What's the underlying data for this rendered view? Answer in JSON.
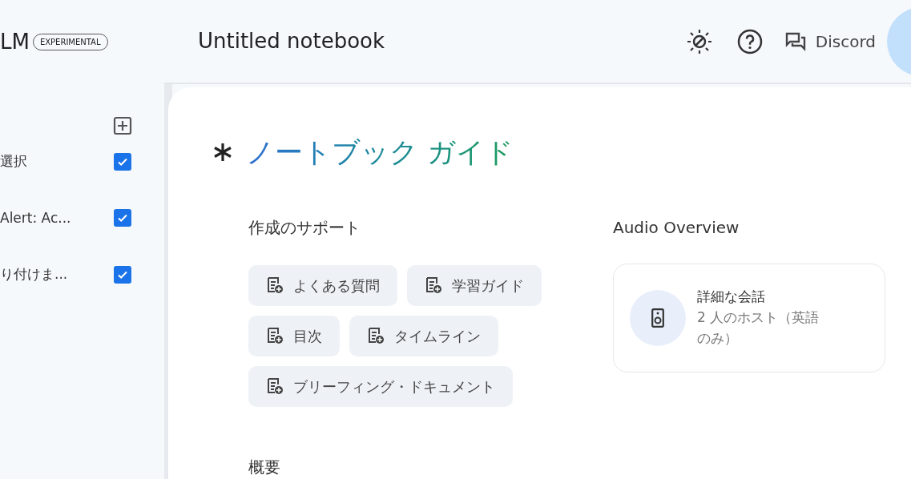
{
  "sidebar": {
    "logo": "LM",
    "badge": "EXPERIMENTAL",
    "sources": [
      {
        "label": "選択",
        "checked": true
      },
      {
        "label": "Alert: Ac...",
        "checked": true
      },
      {
        "label": "り付けま...",
        "checked": true
      }
    ]
  },
  "header": {
    "title": "Untitled notebook",
    "discord": "Discord"
  },
  "guide": {
    "title": "ノートブック ガイド",
    "help_heading": "作成のサポート",
    "chips": [
      {
        "label": "よくある質問"
      },
      {
        "label": "学習ガイド"
      },
      {
        "label": "目次"
      },
      {
        "label": "タイムライン"
      },
      {
        "label": "ブリーフィング・ドキュメント"
      }
    ],
    "audio": {
      "heading": "Audio Overview",
      "card_title": "詳細な会話",
      "card_subtitle": "2 人のホスト（英語のみ）"
    },
    "summary_heading": "概要"
  }
}
